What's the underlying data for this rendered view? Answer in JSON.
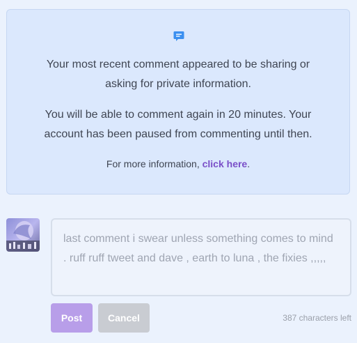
{
  "notice": {
    "icon": "comment-icon",
    "paragraph1": "Your most recent comment appeared to be sharing or asking for private information.",
    "paragraph2": "You will be able to comment again in 20 minutes. Your account has been paused from commenting until then.",
    "more_prefix": "For more information, ",
    "more_link": "click here",
    "more_suffix": "."
  },
  "comment": {
    "text": "last comment i swear unless something comes to mind . ruff ruff tweet and dave , earth to luna , the fixies ,,,,,",
    "post_label": "Post",
    "cancel_label": "Cancel",
    "chars_left": "387 characters left"
  },
  "colors": {
    "page_bg": "#ebf2fd",
    "notice_bg": "#dbe8fd",
    "icon": "#3b8ff0",
    "link": "#7a4fc8",
    "post_button": "#b89ee9",
    "cancel_button": "#c9ccd2"
  }
}
